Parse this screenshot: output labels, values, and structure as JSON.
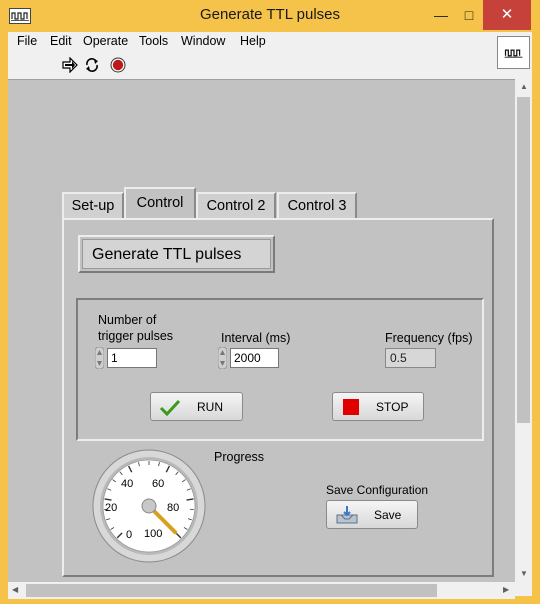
{
  "window": {
    "title": "Generate TTL pulses",
    "minimize": "—",
    "maximize": "□",
    "close": "✕"
  },
  "menu": [
    "File",
    "Edit",
    "Operate",
    "Tools",
    "Window",
    "Help"
  ],
  "toolbar": {
    "icons": [
      "run-arrow-icon",
      "run-continuous-icon",
      "abort-icon"
    ]
  },
  "tabs": [
    "Set-up",
    "Control",
    "Control 2",
    "Control 3"
  ],
  "active_tab": "Control",
  "control": {
    "main_button": "Generate TTL pulses",
    "trigger_label": "Number of trigger pulses",
    "trigger_label_line1": "Number of",
    "trigger_label_line2": "trigger pulses",
    "trigger_value": "1",
    "interval_label": "Interval (ms)",
    "interval_value": "2000",
    "frequency_label": "Frequency (fps)",
    "frequency_value": "0.5",
    "run_label": "RUN",
    "stop_label": "STOP",
    "progress_label": "Progress",
    "gauge": {
      "ticks": [
        "0",
        "20",
        "40",
        "60",
        "80",
        "100"
      ],
      "value": 100,
      "min": 0,
      "max": 100
    },
    "save_config_label": "Save Configuration",
    "save_label": "Save"
  },
  "colors": {
    "titlebar": "#f5c24a",
    "panel": "#c2c2c2",
    "close": "#c7413b",
    "stop_square": "#e00000",
    "needle": "#d8a020"
  }
}
